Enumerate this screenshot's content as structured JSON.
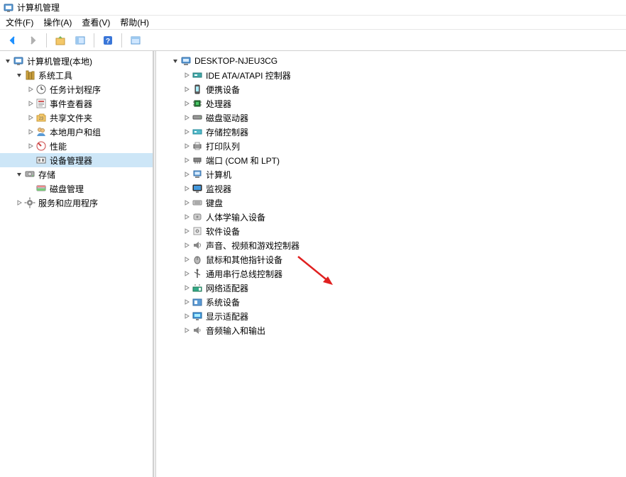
{
  "window": {
    "title": "计算机管理",
    "icon": "computer-mgmt-icon"
  },
  "menu": {
    "file": "文件(F)",
    "action": "操作(A)",
    "view": "查看(V)",
    "help": "帮助(H)"
  },
  "toolbar": {
    "back": "back-arrow-icon",
    "forward": "forward-arrow-icon",
    "up": "up-level-icon",
    "window": "window-icon",
    "help": "help-icon",
    "refresh": "refresh-icon"
  },
  "leftTree": {
    "root": {
      "label": "计算机管理(本地)",
      "icon": "computer-mgmt-icon",
      "expanded": true
    },
    "sysTools": {
      "label": "系统工具",
      "icon": "system-tools-icon",
      "expanded": true
    },
    "sysToolsChildren": [
      {
        "label": "任务计划程序",
        "icon": "task-scheduler-icon",
        "hasChildren": true
      },
      {
        "label": "事件查看器",
        "icon": "event-viewer-icon",
        "hasChildren": true
      },
      {
        "label": "共享文件夹",
        "icon": "shared-folders-icon",
        "hasChildren": true
      },
      {
        "label": "本地用户和组",
        "icon": "users-groups-icon",
        "hasChildren": true
      },
      {
        "label": "性能",
        "icon": "performance-icon",
        "hasChildren": true
      },
      {
        "label": "设备管理器",
        "icon": "device-manager-icon",
        "hasChildren": false,
        "selected": true
      }
    ],
    "storage": {
      "label": "存储",
      "icon": "storage-icon",
      "expanded": true
    },
    "storageChildren": [
      {
        "label": "磁盘管理",
        "icon": "disk-mgmt-icon",
        "hasChildren": false
      }
    ],
    "services": {
      "label": "服务和应用程序",
      "icon": "services-icon",
      "hasChildren": true
    }
  },
  "rightTree": {
    "root": {
      "label": "DESKTOP-NJEU3CG",
      "icon": "computer-icon",
      "expanded": true
    },
    "children": [
      {
        "label": "IDE ATA/ATAPI 控制器",
        "icon": "ide-controller-icon"
      },
      {
        "label": "便携设备",
        "icon": "portable-device-icon"
      },
      {
        "label": "处理器",
        "icon": "processor-icon"
      },
      {
        "label": "磁盘驱动器",
        "icon": "disk-drive-icon"
      },
      {
        "label": "存储控制器",
        "icon": "storage-controller-icon"
      },
      {
        "label": "打印队列",
        "icon": "print-queue-icon"
      },
      {
        "label": "端口 (COM 和 LPT)",
        "icon": "ports-icon"
      },
      {
        "label": "计算机",
        "icon": "computer-device-icon"
      },
      {
        "label": "监视器",
        "icon": "monitor-icon"
      },
      {
        "label": "键盘",
        "icon": "keyboard-icon"
      },
      {
        "label": "人体学输入设备",
        "icon": "hid-icon"
      },
      {
        "label": "软件设备",
        "icon": "software-device-icon"
      },
      {
        "label": "声音、视频和游戏控制器",
        "icon": "sound-video-icon"
      },
      {
        "label": "鼠标和其他指针设备",
        "icon": "mouse-icon"
      },
      {
        "label": "通用串行总线控制器",
        "icon": "usb-icon"
      },
      {
        "label": "网络适配器",
        "icon": "network-adapter-icon"
      },
      {
        "label": "系统设备",
        "icon": "system-device-icon"
      },
      {
        "label": "显示适配器",
        "icon": "display-adapter-icon"
      },
      {
        "label": "音频输入和输出",
        "icon": "audio-io-icon"
      }
    ]
  }
}
